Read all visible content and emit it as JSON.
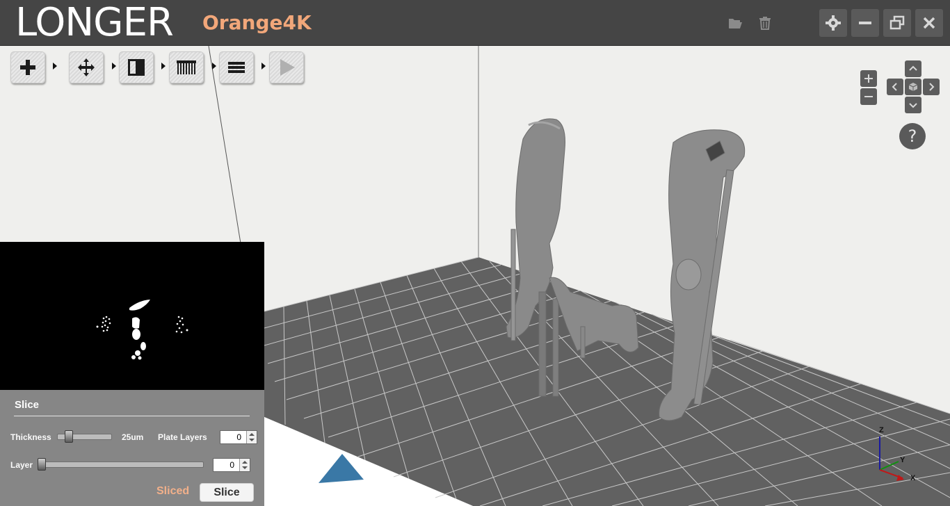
{
  "app": {
    "brand": "LONGER",
    "model": "Orange4K"
  },
  "titlebar_icons": [
    "folder-open-icon",
    "trash-icon",
    "gear-icon",
    "minimize-icon",
    "restore-icon",
    "close-icon"
  ],
  "toolbar": {
    "tools": [
      "add-icon",
      "move-icon",
      "orientation-icon",
      "supports-icon",
      "layers-icon",
      "play-icon"
    ]
  },
  "view_controls": {
    "zoom_in": "+",
    "zoom_out": "−",
    "help": "?"
  },
  "slice_panel": {
    "title": "Slice",
    "thickness_label": "Thickness",
    "thickness_value": "25um",
    "plate_layers_label": "Plate Layers",
    "plate_layers_value": "0",
    "layer_label": "Layer",
    "layer_value": "0",
    "status": "Sliced",
    "slice_button": "Slice"
  },
  "axes": {
    "z": "Z",
    "y": "Y",
    "x": "X"
  },
  "colors": {
    "titlebar": "#454545",
    "model_name": "#f2a77a",
    "build_plate": "#616161",
    "slice_panel": "#868686",
    "status_text": "#f2b08a"
  }
}
